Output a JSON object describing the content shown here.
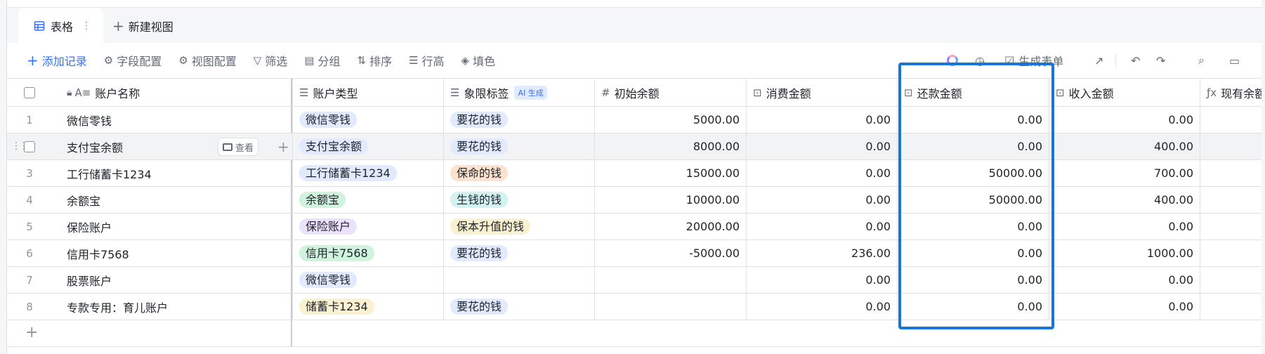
{
  "tabs": {
    "active": "表格",
    "more_icon": "⋮",
    "new_view": "新建视图"
  },
  "toolbar": {
    "add_record": "添加记录",
    "field_config": "字段配置",
    "view_config": "视图配置",
    "filter": "筛选",
    "group": "分组",
    "sort": "排序",
    "row_height": "行高",
    "fill": "填色",
    "generate_form": "生成表单"
  },
  "columns": {
    "name": "账户名称",
    "type": "账户类型",
    "quadrant": "象限标签",
    "quadrant_badge": "AI 生成",
    "initial": "初始余额",
    "spend": "消费金额",
    "repay": "还款金额",
    "income": "收入金额",
    "current": "现有余额"
  },
  "row_actions": {
    "view": "查看"
  },
  "rows": [
    {
      "num": "1",
      "name": "微信零钱",
      "type": "微信零钱",
      "type_color": "blue",
      "quadrant": "要花的钱",
      "quadrant_color": "blue",
      "initial": "5000.00",
      "spend": "0.00",
      "repay": "0.00",
      "income": "0.00"
    },
    {
      "num": "2",
      "name": "支付宝余额",
      "type": "支付宝余额",
      "type_color": "blue",
      "quadrant": "要花的钱",
      "quadrant_color": "blue",
      "initial": "8000.00",
      "spend": "0.00",
      "repay": "0.00",
      "income": "400.00"
    },
    {
      "num": "3",
      "name": "工行储蓄卡1234",
      "type": "工行储蓄卡1234",
      "type_color": "blue",
      "quadrant": "保命的钱",
      "quadrant_color": "orange",
      "initial": "15000.00",
      "spend": "0.00",
      "repay": "50000.00",
      "income": "700.00"
    },
    {
      "num": "4",
      "name": "余额宝",
      "type": "余额宝",
      "type_color": "green",
      "quadrant": "生钱的钱",
      "quadrant_color": "cyan",
      "initial": "10000.00",
      "spend": "0.00",
      "repay": "50000.00",
      "income": "400.00"
    },
    {
      "num": "5",
      "name": "保险账户",
      "type": "保险账户",
      "type_color": "purple",
      "quadrant": "保本升值的钱",
      "quadrant_color": "yellow",
      "initial": "20000.00",
      "spend": "0.00",
      "repay": "0.00",
      "income": "0.00"
    },
    {
      "num": "6",
      "name": "信用卡7568",
      "type": "信用卡7568",
      "type_color": "green",
      "quadrant": "要花的钱",
      "quadrant_color": "blue",
      "initial": "-5000.00",
      "spend": "236.00",
      "repay": "0.00",
      "income": "1000.00"
    },
    {
      "num": "7",
      "name": "股票账户",
      "type": "微信零钱",
      "type_color": "blue",
      "quadrant": "",
      "quadrant_color": "",
      "initial": "",
      "spend": "0.00",
      "repay": "0.00",
      "income": "0.00"
    },
    {
      "num": "8",
      "name": "专款专用：育儿账户",
      "type": "储蓄卡1234",
      "type_color": "yellow",
      "quadrant": "要花的钱",
      "quadrant_color": "blue",
      "initial": "",
      "spend": "0.00",
      "repay": "0.00",
      "income": "0.00"
    }
  ],
  "colors": {
    "accent": "#3370ff",
    "highlight": "#1677d6"
  }
}
